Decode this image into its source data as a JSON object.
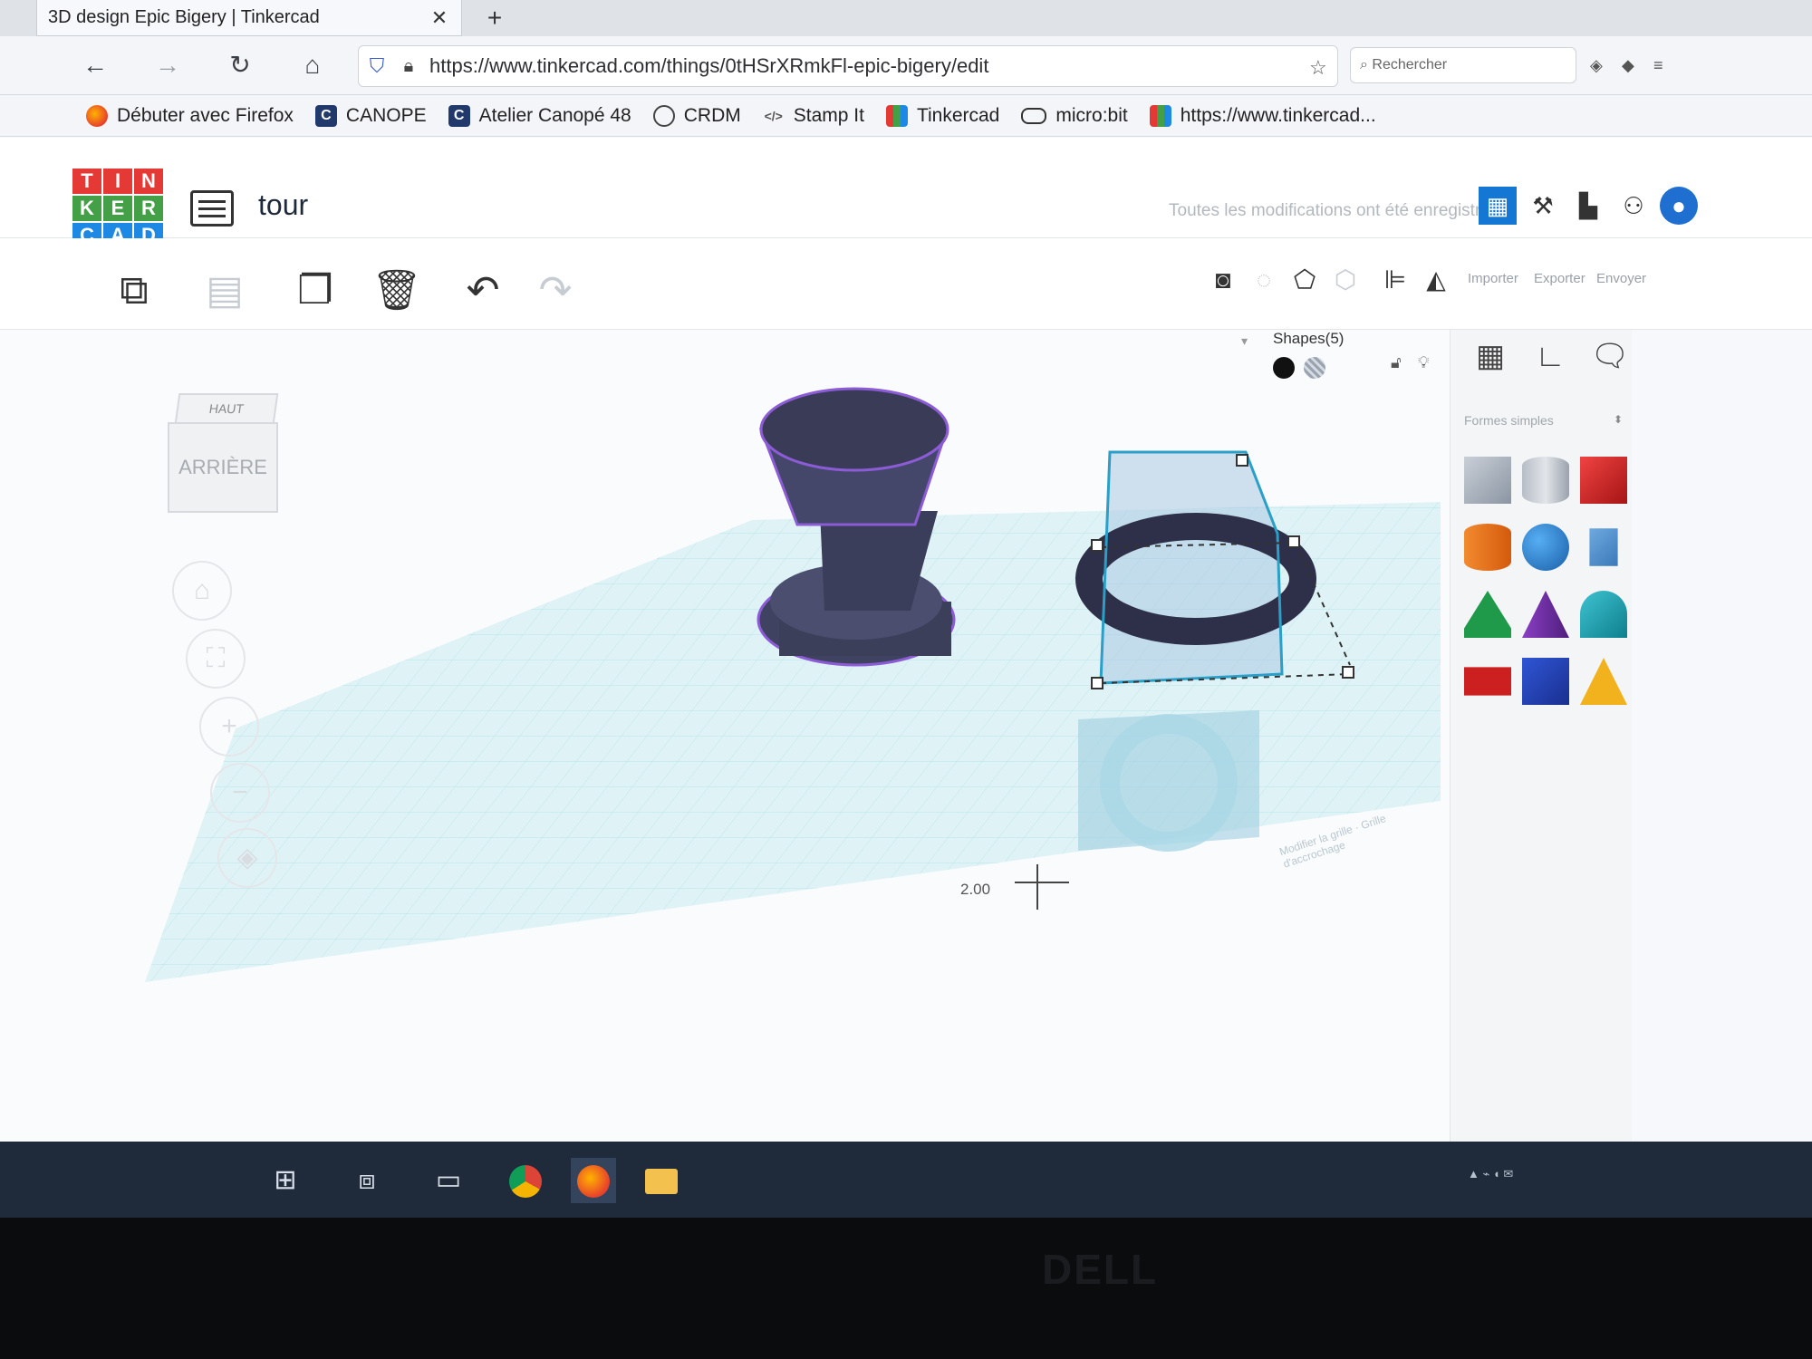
{
  "browser": {
    "tab_title": "3D design Epic Bigery | Tinkercad",
    "tab_close": "✕",
    "new_tab": "+",
    "url": "https://www.tinkercad.com/things/0tHSrXRmkFl-epic-bigery/edit",
    "search_placeholder": "Rechercher",
    "bookmarks": [
      {
        "label": "Débuter avec Firefox",
        "icon": "firefox-icon"
      },
      {
        "label": "CANOPE",
        "icon": "canope-icon"
      },
      {
        "label": "Atelier Canopé 48",
        "icon": "canope-icon"
      },
      {
        "label": "CRDM",
        "icon": "globe-icon"
      },
      {
        "label": "Stamp It",
        "icon": "code-icon"
      },
      {
        "label": "Tinkercad",
        "icon": "tinkercad-icon"
      },
      {
        "label": "micro:bit",
        "icon": "microbit-icon"
      },
      {
        "label": "https://www.tinkercad...",
        "icon": "tinkercad-icon"
      }
    ]
  },
  "app": {
    "logo_letters": [
      "T",
      "I",
      "N",
      "K",
      "E",
      "R",
      "C",
      "A",
      "D"
    ],
    "project_title": "tour",
    "save_status": "Toutes les modifications ont été enregistrées",
    "right_links": [
      "Importer",
      "Exporter",
      "Envoyer"
    ]
  },
  "inspector": {
    "title": "Shapes(5)"
  },
  "viewcube": {
    "top_label": "HAUT",
    "front_label": "ARRIÈRE"
  },
  "workplane": {
    "snap_value": "2.00",
    "snap_label": "Grille d'accrochage",
    "edit_grid": "Modifier la grille"
  },
  "panel": {
    "category": "Formes simples"
  },
  "colors": {
    "accent": "#1477d4",
    "workplane": "#9fd8e2",
    "solid_shape": "#3c3f5a",
    "selection": "#36b7d6"
  },
  "laptop_brand": "DELL"
}
